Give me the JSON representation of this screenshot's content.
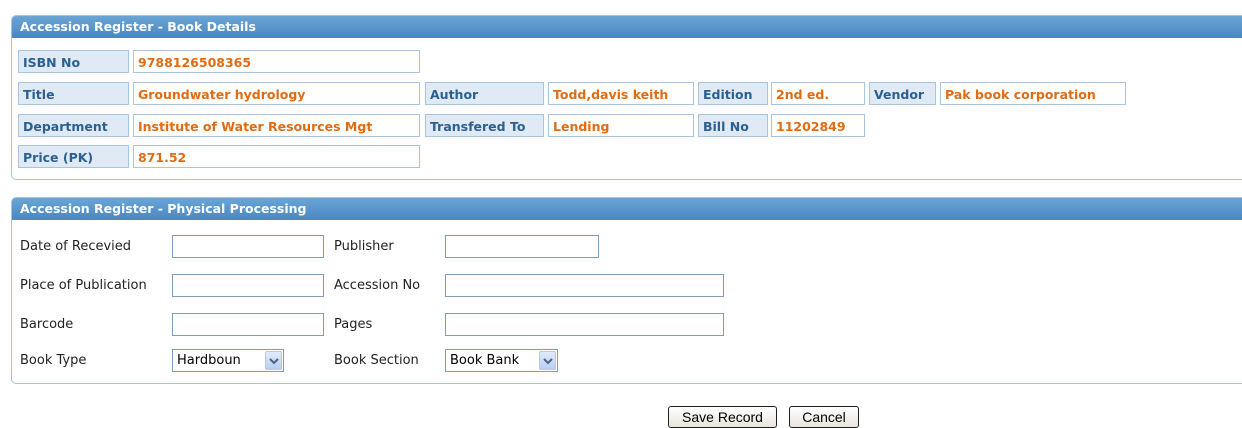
{
  "book_details": {
    "title": "Accession Register - Book Details",
    "isbn_label": "ISBN No",
    "isbn_value": "9788126508365",
    "title_label": "Title",
    "title_value": "Groundwater hydrology",
    "author_label": "Author",
    "author_value": "Todd,davis keith",
    "edition_label": "Edition",
    "edition_value": "2nd ed.",
    "vendor_label": "Vendor",
    "vendor_value": "Pak book corporation",
    "department_label": "Department",
    "department_value": "Institute of Water Resources Mgt",
    "transfered_label": "Transfered To",
    "transfered_value": "Lending",
    "bill_label": "Bill No",
    "bill_value": "11202849",
    "price_label": "Price (PK)",
    "price_value": "871.52"
  },
  "physical_processing": {
    "title": "Accession Register - Physical Processing",
    "date_received_label": "Date of Recevied",
    "date_received_value": "",
    "publisher_label": "Publisher",
    "publisher_value": "",
    "place_label": "Place of Publication",
    "place_value": "",
    "accession_label": "Accession No",
    "accession_value": "",
    "barcode_label": "Barcode",
    "barcode_value": "",
    "pages_label": "Pages",
    "pages_value": "",
    "book_type_label": "Book Type",
    "book_type_selected": "Hardboun",
    "book_section_label": "Book Section",
    "book_section_selected": "Book Bank"
  },
  "actions": {
    "save_label": "Save Record",
    "cancel_label": "Cancel"
  },
  "colors": {
    "header_blue": "#4a87c0",
    "label_text": "#2b5f91",
    "value_text": "#e26b10",
    "label_bg": "#dfeaf5"
  }
}
